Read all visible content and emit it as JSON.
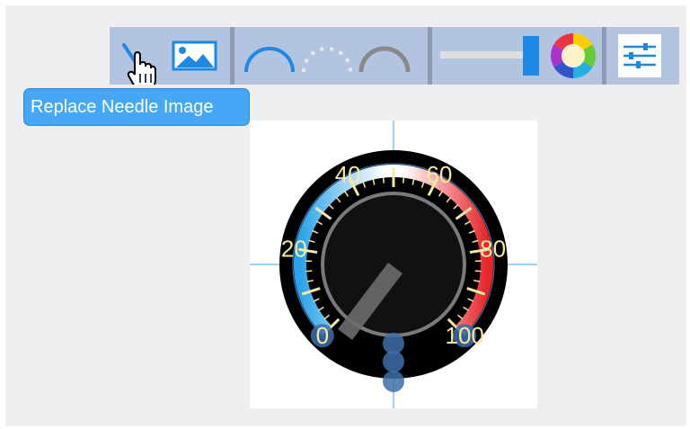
{
  "toolbar": {
    "buttons": [
      {
        "name": "replace-needle-button",
        "icon": "needle-icon",
        "active": true
      },
      {
        "name": "replace-image-button",
        "icon": "image-icon"
      },
      {
        "name": "arc-style-button",
        "icon": "arc-icon"
      },
      {
        "name": "tick-style-button",
        "icon": "dashed-arc-icon"
      },
      {
        "name": "track-style-button",
        "icon": "gray-arc-icon"
      },
      {
        "name": "slider-control",
        "icon": "slider-icon"
      },
      {
        "name": "color-picker-button",
        "icon": "color-wheel-icon"
      },
      {
        "name": "settings-button",
        "icon": "sliders-icon"
      }
    ]
  },
  "tooltip": {
    "text": "Replace Needle Image"
  },
  "gauge": {
    "min": 0,
    "max": 100,
    "major_labels": [
      "0",
      "20",
      "40",
      "60",
      "80",
      "100"
    ],
    "colors": {
      "cold": "#2aa3e8",
      "hot": "#e8262a",
      "label": "#f3e9a6",
      "needle": "#6b6b6b",
      "face": "#111111",
      "bezel": "#000000",
      "handle": "#3d6fa8",
      "guide": "#9fd0f5"
    }
  }
}
